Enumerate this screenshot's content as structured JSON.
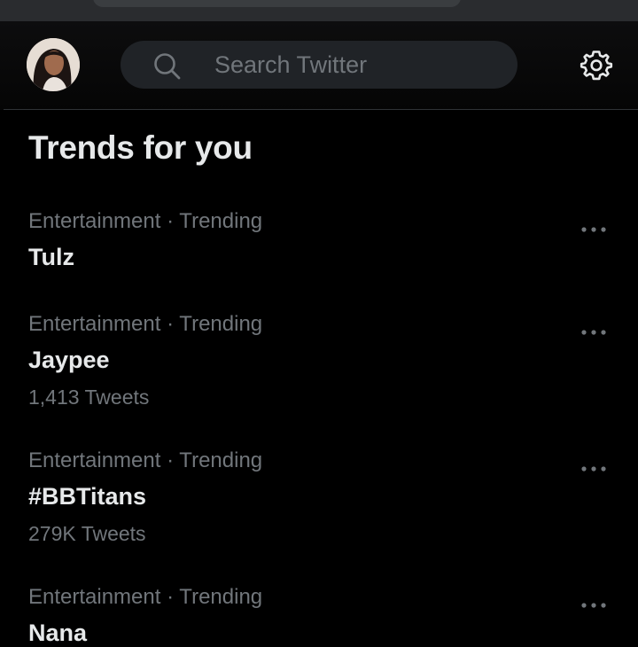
{
  "search": {
    "placeholder": "Search Twitter"
  },
  "section": {
    "title": "Trends for you"
  },
  "trends": [
    {
      "meta": "Entertainment · Trending",
      "name": "Tulz",
      "count": ""
    },
    {
      "meta": "Entertainment · Trending",
      "name": "Jaypee",
      "count": "1,413 Tweets"
    },
    {
      "meta": "Entertainment · Trending",
      "name": "#BBTitans",
      "count": "279K Tweets"
    },
    {
      "meta": "Entertainment · Trending",
      "name": "Nana",
      "count": ""
    }
  ],
  "icons": {
    "avatar": "user-avatar",
    "search": "search-icon",
    "settings": "gear-icon",
    "more": "more-horizontal-icon"
  },
  "colors": {
    "background": "#000000",
    "primary_text": "#e7e9ea",
    "secondary_text": "#71767b",
    "search_background": "#202327"
  }
}
